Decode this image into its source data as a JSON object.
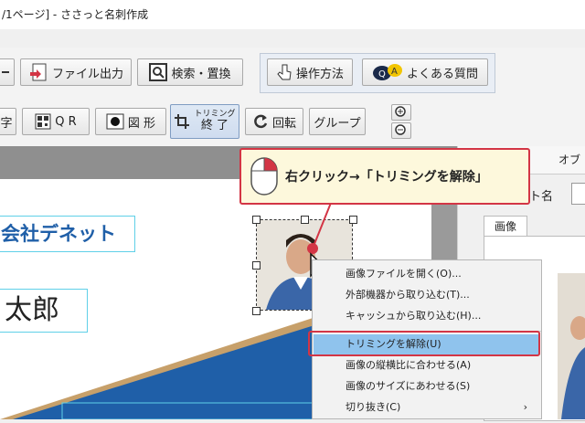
{
  "window": {
    "title": "/1ページ] - ささっと名刺作成"
  },
  "toolbar1": {
    "file_output": "ファイル出力",
    "search_replace": "検索・置換",
    "how_to": "操作方法",
    "faq": "よくある質問"
  },
  "toolbar2": {
    "text_partial": "字",
    "qr": "Q R",
    "shape": "図 形",
    "trim_line1": "トリミング",
    "trim_line2": "終 了",
    "rotate": "回転",
    "group": "グループ"
  },
  "panel": {
    "header_partial": "オブ",
    "font_label_partial": "ト名",
    "tab_image": "画像"
  },
  "card": {
    "company": "会社デネット",
    "name_partial": "太郎"
  },
  "callout": {
    "text": "右クリック→「トリミングを解除」"
  },
  "context_menu": {
    "items": [
      {
        "label": "画像ファイルを開く(O)..."
      },
      {
        "label": "外部機器から取り込む(T)..."
      },
      {
        "label": "キャッシュから取り込む(H)..."
      },
      {
        "label": "トリミングを解除(U)"
      },
      {
        "label": "画像の縦横比に合わせる(A)"
      },
      {
        "label": "画像のサイズにあわせる(S)"
      },
      {
        "label": "切り抜き(C)"
      }
    ],
    "highlighted_index": 3
  },
  "colors": {
    "accent_red": "#d33545",
    "callout_bg": "#fdf8dc",
    "highlight": "#8fc3ed",
    "brand_blue": "#1f5fa8"
  }
}
